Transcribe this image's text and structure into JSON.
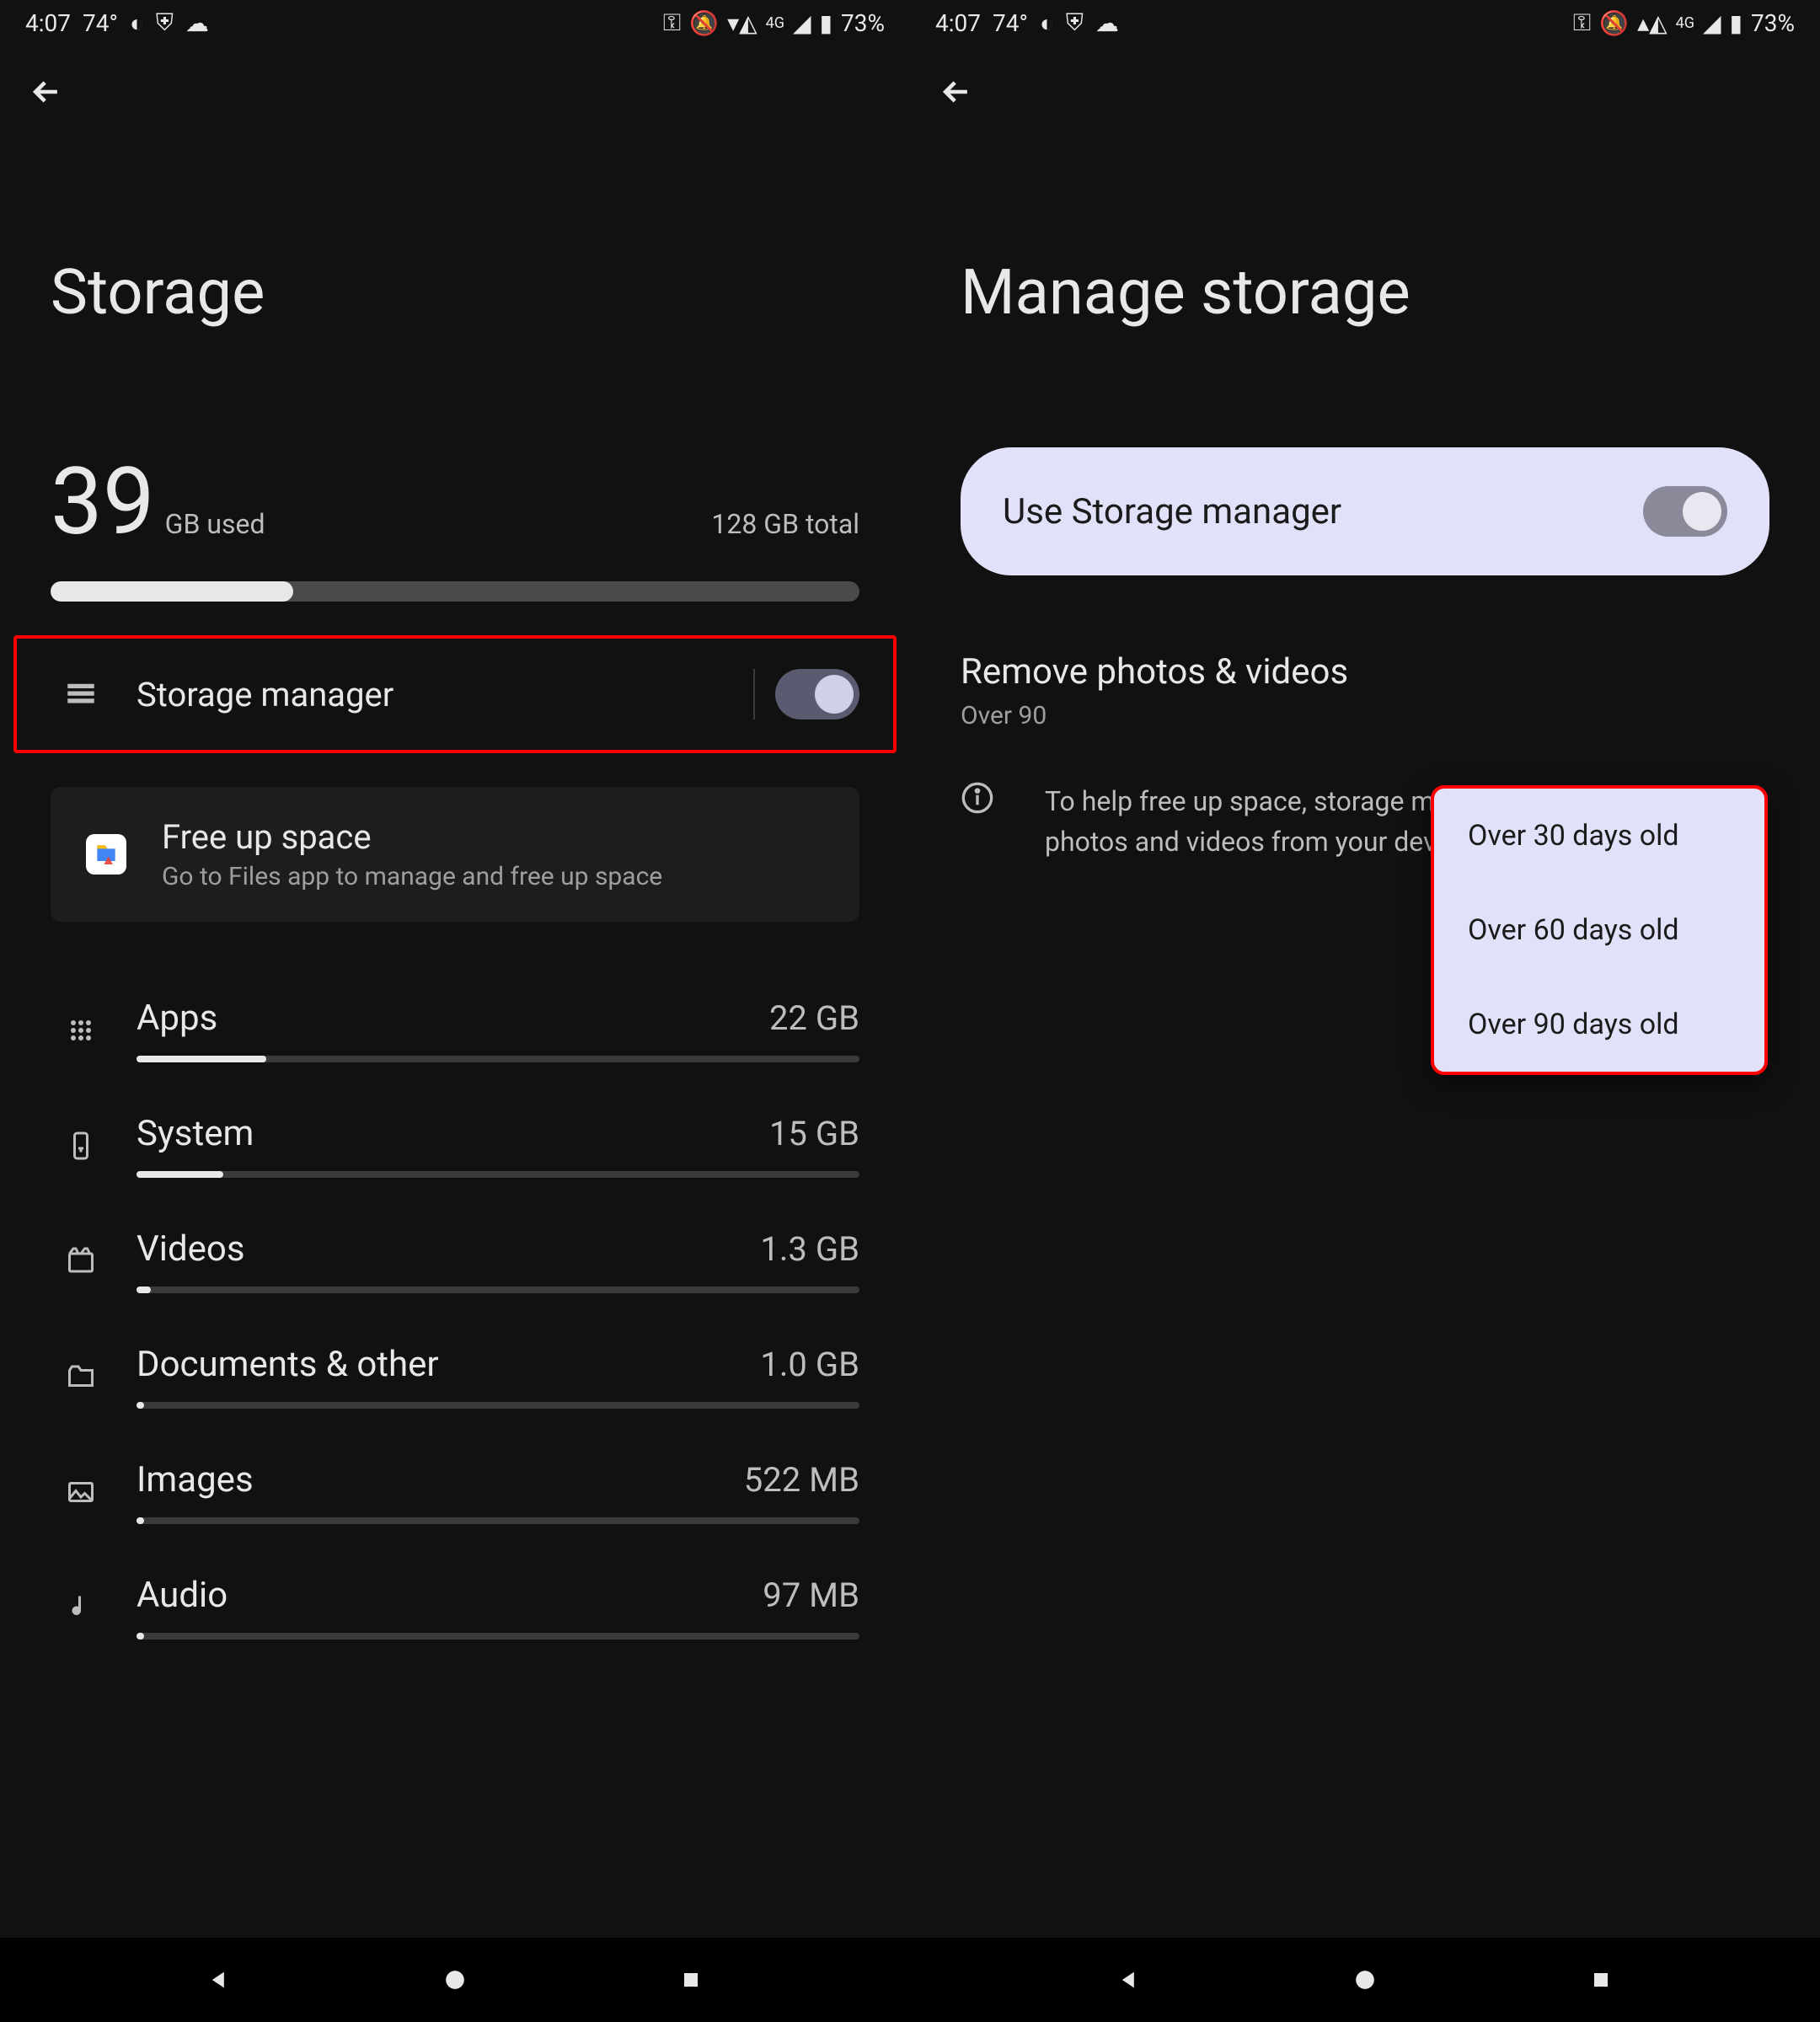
{
  "statusbar": {
    "time": "4:07",
    "temp": "74°",
    "battery_pct": "73%",
    "network_label": "4G"
  },
  "left": {
    "title": "Storage",
    "used_num": "39",
    "used_unit": "GB used",
    "total": "128 GB total",
    "progress_pct": 30,
    "storage_manager": {
      "label": "Storage manager",
      "on": true
    },
    "free_up": {
      "title": "Free up space",
      "subtitle": "Go to Files app to manage and free up space"
    },
    "items": [
      {
        "name": "Apps",
        "size": "22 GB",
        "pct": 18
      },
      {
        "name": "System",
        "size": "15 GB",
        "pct": 12
      },
      {
        "name": "Videos",
        "size": "1.3 GB",
        "pct": 2
      },
      {
        "name": "Documents & other",
        "size": "1.0 GB",
        "pct": 1
      },
      {
        "name": "Images",
        "size": "522 MB",
        "pct": 1
      },
      {
        "name": "Audio",
        "size": "97 MB",
        "pct": 0
      }
    ]
  },
  "right": {
    "title": "Manage storage",
    "use_sm": "Use Storage manager",
    "remove_head": "Remove photos & videos",
    "remove_sub": "Over 90",
    "info": "To help free up space, storage manager removes backed up photos and videos from your device.",
    "popup": [
      "Over 30 days old",
      "Over 60 days old",
      "Over 90 days old"
    ]
  }
}
